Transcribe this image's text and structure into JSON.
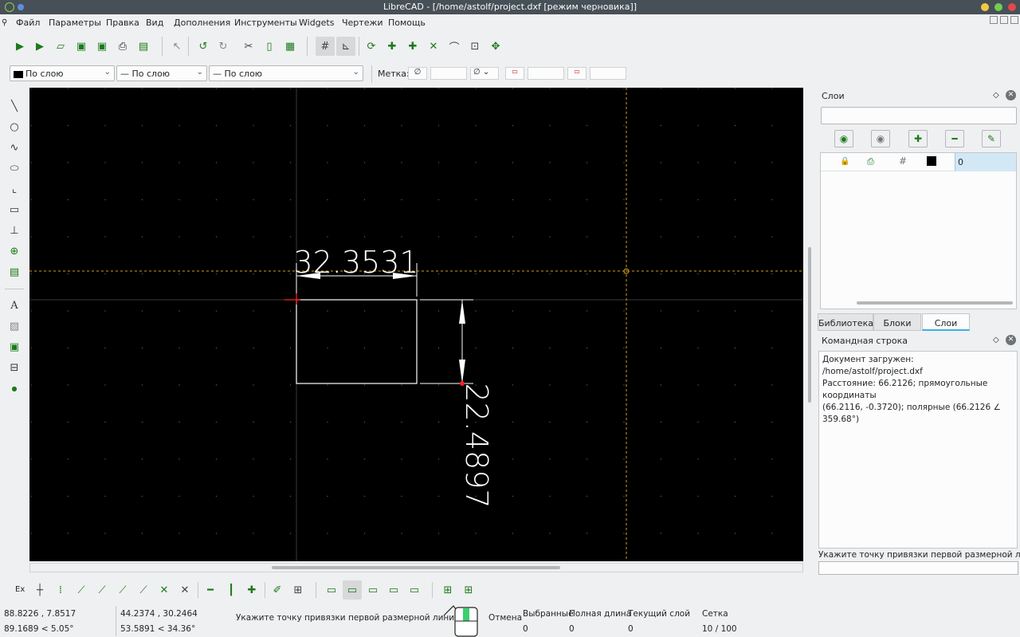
{
  "window": {
    "title": "LibreCAD - [/home/astolf/project.dxf [режим черновика]]"
  },
  "menu": [
    "Файл",
    "Параметры",
    "Правка",
    "Вид",
    "Дополнения",
    "Инструменты",
    "Widgets",
    "Чертежи",
    "Помощь"
  ],
  "props": {
    "color": "По слою",
    "linewidth": "По слою",
    "linetype": "По слою",
    "label": "Метка:"
  },
  "drawing": {
    "dim_horizontal": "32.3531",
    "dim_vertical": "22.4897"
  },
  "layers_panel": {
    "title": "Слои",
    "search_value": "",
    "layers": [
      {
        "name": "0"
      }
    ],
    "tabs": [
      "Библиотека",
      "Блоки",
      "Слои"
    ],
    "active_tab": "Слои"
  },
  "command_panel": {
    "title": "Командная строка",
    "lines": [
      "Документ загружен: /home/astolf/project.dxf",
      "Расстояние: 66.2126; прямоугольные координаты",
      "(66.2116, -0.3720); полярные (66.2126 ∠ 359.68°)"
    ],
    "prompt": "Укажите точку привязки первой размерной линии",
    "input_value": ""
  },
  "snap_toolbar": {
    "ex_label": "Ex"
  },
  "status": {
    "abs_coords": "88.8226 , 7.8517",
    "abs_polar": "89.1689 < 5.05°",
    "rel_coords": "44.2374 , 30.2464",
    "rel_polar": "53.5891 < 34.36°",
    "prompt": "Укажите точку привязки первой размерной линии",
    "cancel": "Отмена",
    "selected_label": "Выбранные",
    "selected_value": "0",
    "total_length_label": "Полная длина",
    "total_length_value": "0",
    "current_layer_label": "Текущий слой",
    "current_layer_value": "0",
    "grid_label": "Сетка",
    "grid_value": "10 / 100"
  },
  "colors": {
    "canvas_bg": "#000000",
    "crosshair": "#d4a017",
    "entity": "#ffffff",
    "accent": "#3daee9"
  }
}
